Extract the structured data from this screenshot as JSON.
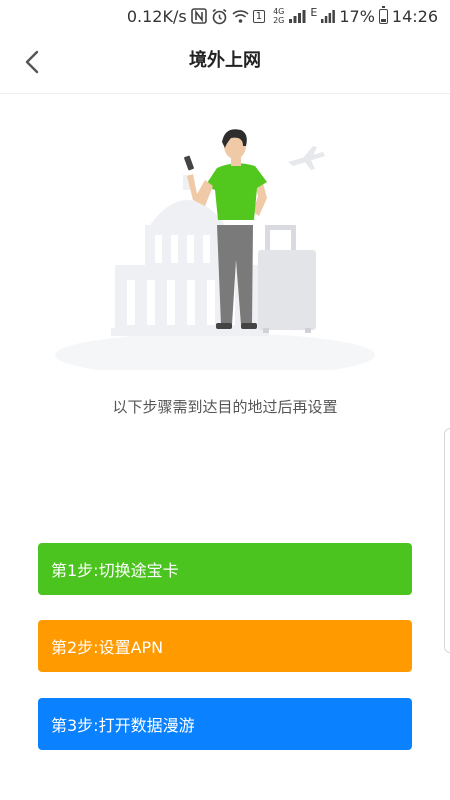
{
  "status_bar": {
    "speed": "0.12K/s",
    "network_4g": "4G",
    "network_2g": "2G",
    "edge": "E",
    "battery": "17%",
    "time": "14:26",
    "sim_number": "1",
    "icons": [
      "nfc-icon",
      "alarm-icon",
      "wifi-icon",
      "sim-icon",
      "signal-icon",
      "battery-icon"
    ]
  },
  "header": {
    "title": "境外上网",
    "back_icon": "chevron-left-icon"
  },
  "main": {
    "subtitle": "以下步骤需到达目的地过后再设置",
    "steps": [
      {
        "label": "第1步:切换途宝卡",
        "color": "#4CC41F"
      },
      {
        "label": "第2步:设置APN",
        "color": "#FF9A00"
      },
      {
        "label": "第3步:打开数据漫游",
        "color": "#0A82FF"
      }
    ]
  },
  "colors": {
    "shirt": "#52C81E",
    "pants": "#7A7A7A",
    "suitcase": "#E3E4E8"
  }
}
